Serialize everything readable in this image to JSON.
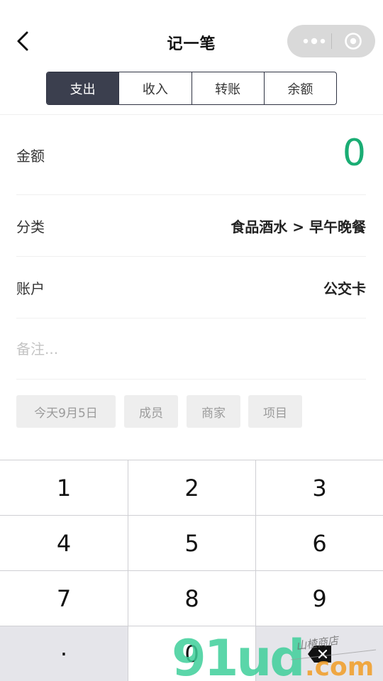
{
  "header": {
    "title": "记一笔",
    "back_icon": "chevron-left-icon",
    "capsule": {
      "more_icon": "more-dots-icon",
      "close_icon": "close-circle-icon"
    }
  },
  "tabs": [
    {
      "label": "支出",
      "active": true
    },
    {
      "label": "收入",
      "active": false
    },
    {
      "label": "转账",
      "active": false
    },
    {
      "label": "余额",
      "active": false
    }
  ],
  "form": {
    "amount": {
      "label": "金额",
      "value": "0",
      "color": "#1aad74"
    },
    "category": {
      "label": "分类",
      "value": "食品酒水 > 早午晚餐"
    },
    "account": {
      "label": "账户",
      "value": "公交卡"
    },
    "note": {
      "placeholder": "备注..."
    }
  },
  "chips": [
    {
      "label": "今天9月5日"
    },
    {
      "label": "成员"
    },
    {
      "label": "商家"
    },
    {
      "label": "项目"
    }
  ],
  "keypad": {
    "keys": [
      "1",
      "2",
      "3",
      "4",
      "5",
      "6",
      "7",
      "8",
      "9",
      "·",
      "0"
    ],
    "backspace_icon": "backspace-icon"
  },
  "watermark": {
    "main": "91ud",
    "suffix": ".com",
    "script": "山楂商店"
  },
  "colors": {
    "accent": "#1aad74",
    "tab_active_bg": "#3b3f4e"
  }
}
